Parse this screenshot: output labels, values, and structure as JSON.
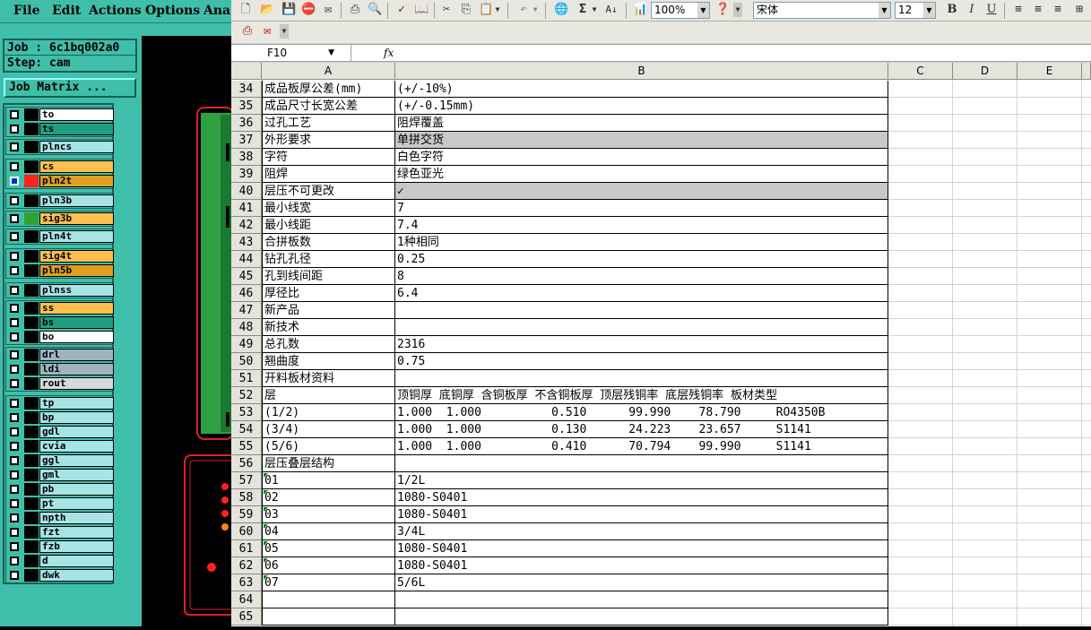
{
  "cam": {
    "menu": [
      "File",
      "Edit",
      "Actions",
      "Options",
      "Ana"
    ],
    "job_label": "Job : 6c1bq002a0",
    "step_label": "Step: cam",
    "job_matrix_button": "Job Matrix ...",
    "layers": [
      {
        "name": "to",
        "color": "#ffffff"
      },
      {
        "name": "ts",
        "color": "#1f9f7f"
      },
      {
        "name": "plncs",
        "color": "#a6e4e6"
      },
      {
        "name": "cs",
        "color": "#ffbf4f"
      },
      {
        "name": "pln2t",
        "color": "#df9f20",
        "active": true
      },
      {
        "name": "pln3b",
        "color": "#a6e4e6"
      },
      {
        "name": "sig3b",
        "color": "#ffbf4f"
      },
      {
        "name": "pln4t",
        "color": "#a6e4e6"
      },
      {
        "name": "sig4t",
        "color": "#ffbf4f"
      },
      {
        "name": "pln5b",
        "color": "#df9f20"
      },
      {
        "name": "plnss",
        "color": "#a6e4e6"
      },
      {
        "name": "ss",
        "color": "#ffbf4f"
      },
      {
        "name": "bs",
        "color": "#1f9f7f"
      },
      {
        "name": "bo",
        "color": "#ffffff"
      },
      {
        "name": "drl",
        "color": "#9fb4bf"
      },
      {
        "name": "ldi",
        "color": "#9fb4bf"
      },
      {
        "name": "rout",
        "color": "#d8d8d8"
      },
      {
        "name": "tp",
        "color": "#a6e4e6"
      },
      {
        "name": "bp",
        "color": "#a6e4e6"
      },
      {
        "name": "gdl",
        "color": "#a6e4e6"
      },
      {
        "name": "cvia",
        "color": "#a6e4e6"
      },
      {
        "name": "ggl",
        "color": "#a6e4e6"
      },
      {
        "name": "gml",
        "color": "#a6e4e6"
      },
      {
        "name": "pb",
        "color": "#a6e4e6"
      },
      {
        "name": "pt",
        "color": "#a6e4e6"
      },
      {
        "name": "npth",
        "color": "#a6e4e6"
      },
      {
        "name": "fzt",
        "color": "#a6e4e6"
      },
      {
        "name": "fzb",
        "color": "#a6e4e6"
      },
      {
        "name": "d",
        "color": "#a6e4e6"
      },
      {
        "name": "dwk",
        "color": "#a6e4e6"
      }
    ]
  },
  "excel": {
    "zoom": "100%",
    "font_name": "宋体",
    "font_size": "12",
    "name_box": "F10",
    "fx": "fx",
    "columns": [
      "A",
      "B",
      "C",
      "D",
      "E"
    ],
    "rows": [
      {
        "n": "34",
        "a": "成品板厚公差(mm)",
        "b": "(+/-10%)"
      },
      {
        "n": "35",
        "a": "成品尺寸长宽公差",
        "b": "(+/-0.15mm)"
      },
      {
        "n": "36",
        "a": "过孔工艺",
        "b": "阻焊覆盖"
      },
      {
        "n": "37",
        "a": "外形要求",
        "b": "单拼交货",
        "gray": true
      },
      {
        "n": "38",
        "a": "字符",
        "b": "白色字符"
      },
      {
        "n": "39",
        "a": "阻焊",
        "b": "绿色亚光"
      },
      {
        "n": "40",
        "a": "层压不可更改",
        "b": "✓",
        "gray": true
      },
      {
        "n": "41",
        "a": "最小线宽",
        "b": "7"
      },
      {
        "n": "42",
        "a": "最小线距",
        "b": "7.4"
      },
      {
        "n": "43",
        "a": "合拼板数",
        "b": "1种相同"
      },
      {
        "n": "44",
        "a": "钻孔孔径",
        "b": "0.25"
      },
      {
        "n": "45",
        "a": "孔到线间距",
        "b": "8"
      },
      {
        "n": "46",
        "a": "厚径比",
        "b": "6.4"
      },
      {
        "n": "47",
        "a": "新产品",
        "b": ""
      },
      {
        "n": "48",
        "a": "新技术",
        "b": ""
      },
      {
        "n": "49",
        "a": "总孔数",
        "b": "2316"
      },
      {
        "n": "50",
        "a": "翘曲度",
        "b": "0.75"
      },
      {
        "n": "51",
        "a": "开料板材资料",
        "b": ""
      },
      {
        "n": "52",
        "a": "层",
        "b": "顶铜厚 底铜厚 含铜板厚 不含铜板厚 顶层残铜率 底层残铜率 板材类型"
      },
      {
        "n": "53",
        "a": "(1/2)",
        "b": "1.000  1.000          0.510      99.990    78.790     RO4350B"
      },
      {
        "n": "54",
        "a": "(3/4)",
        "b": "1.000  1.000          0.130      24.223    23.657     S1141"
      },
      {
        "n": "55",
        "a": "(5/6)",
        "b": "1.000  1.000          0.410      70.794    99.990     S1141"
      },
      {
        "n": "56",
        "a": "层压叠层结构",
        "b": ""
      },
      {
        "n": "57",
        "a": "01",
        "b": "1/2L",
        "tri": true
      },
      {
        "n": "58",
        "a": "02",
        "b": "1080-S0401",
        "tri": true
      },
      {
        "n": "59",
        "a": "03",
        "b": "1080-S0401",
        "tri": true
      },
      {
        "n": "60",
        "a": "04",
        "b": "3/4L",
        "tri": true
      },
      {
        "n": "61",
        "a": "05",
        "b": "1080-S0401",
        "tri": true
      },
      {
        "n": "62",
        "a": "06",
        "b": "1080-S0401",
        "tri": true
      },
      {
        "n": "63",
        "a": "07",
        "b": "5/6L",
        "tri": true
      },
      {
        "n": "64",
        "a": "",
        "b": ""
      },
      {
        "n": "65",
        "a": "",
        "b": ""
      }
    ]
  }
}
